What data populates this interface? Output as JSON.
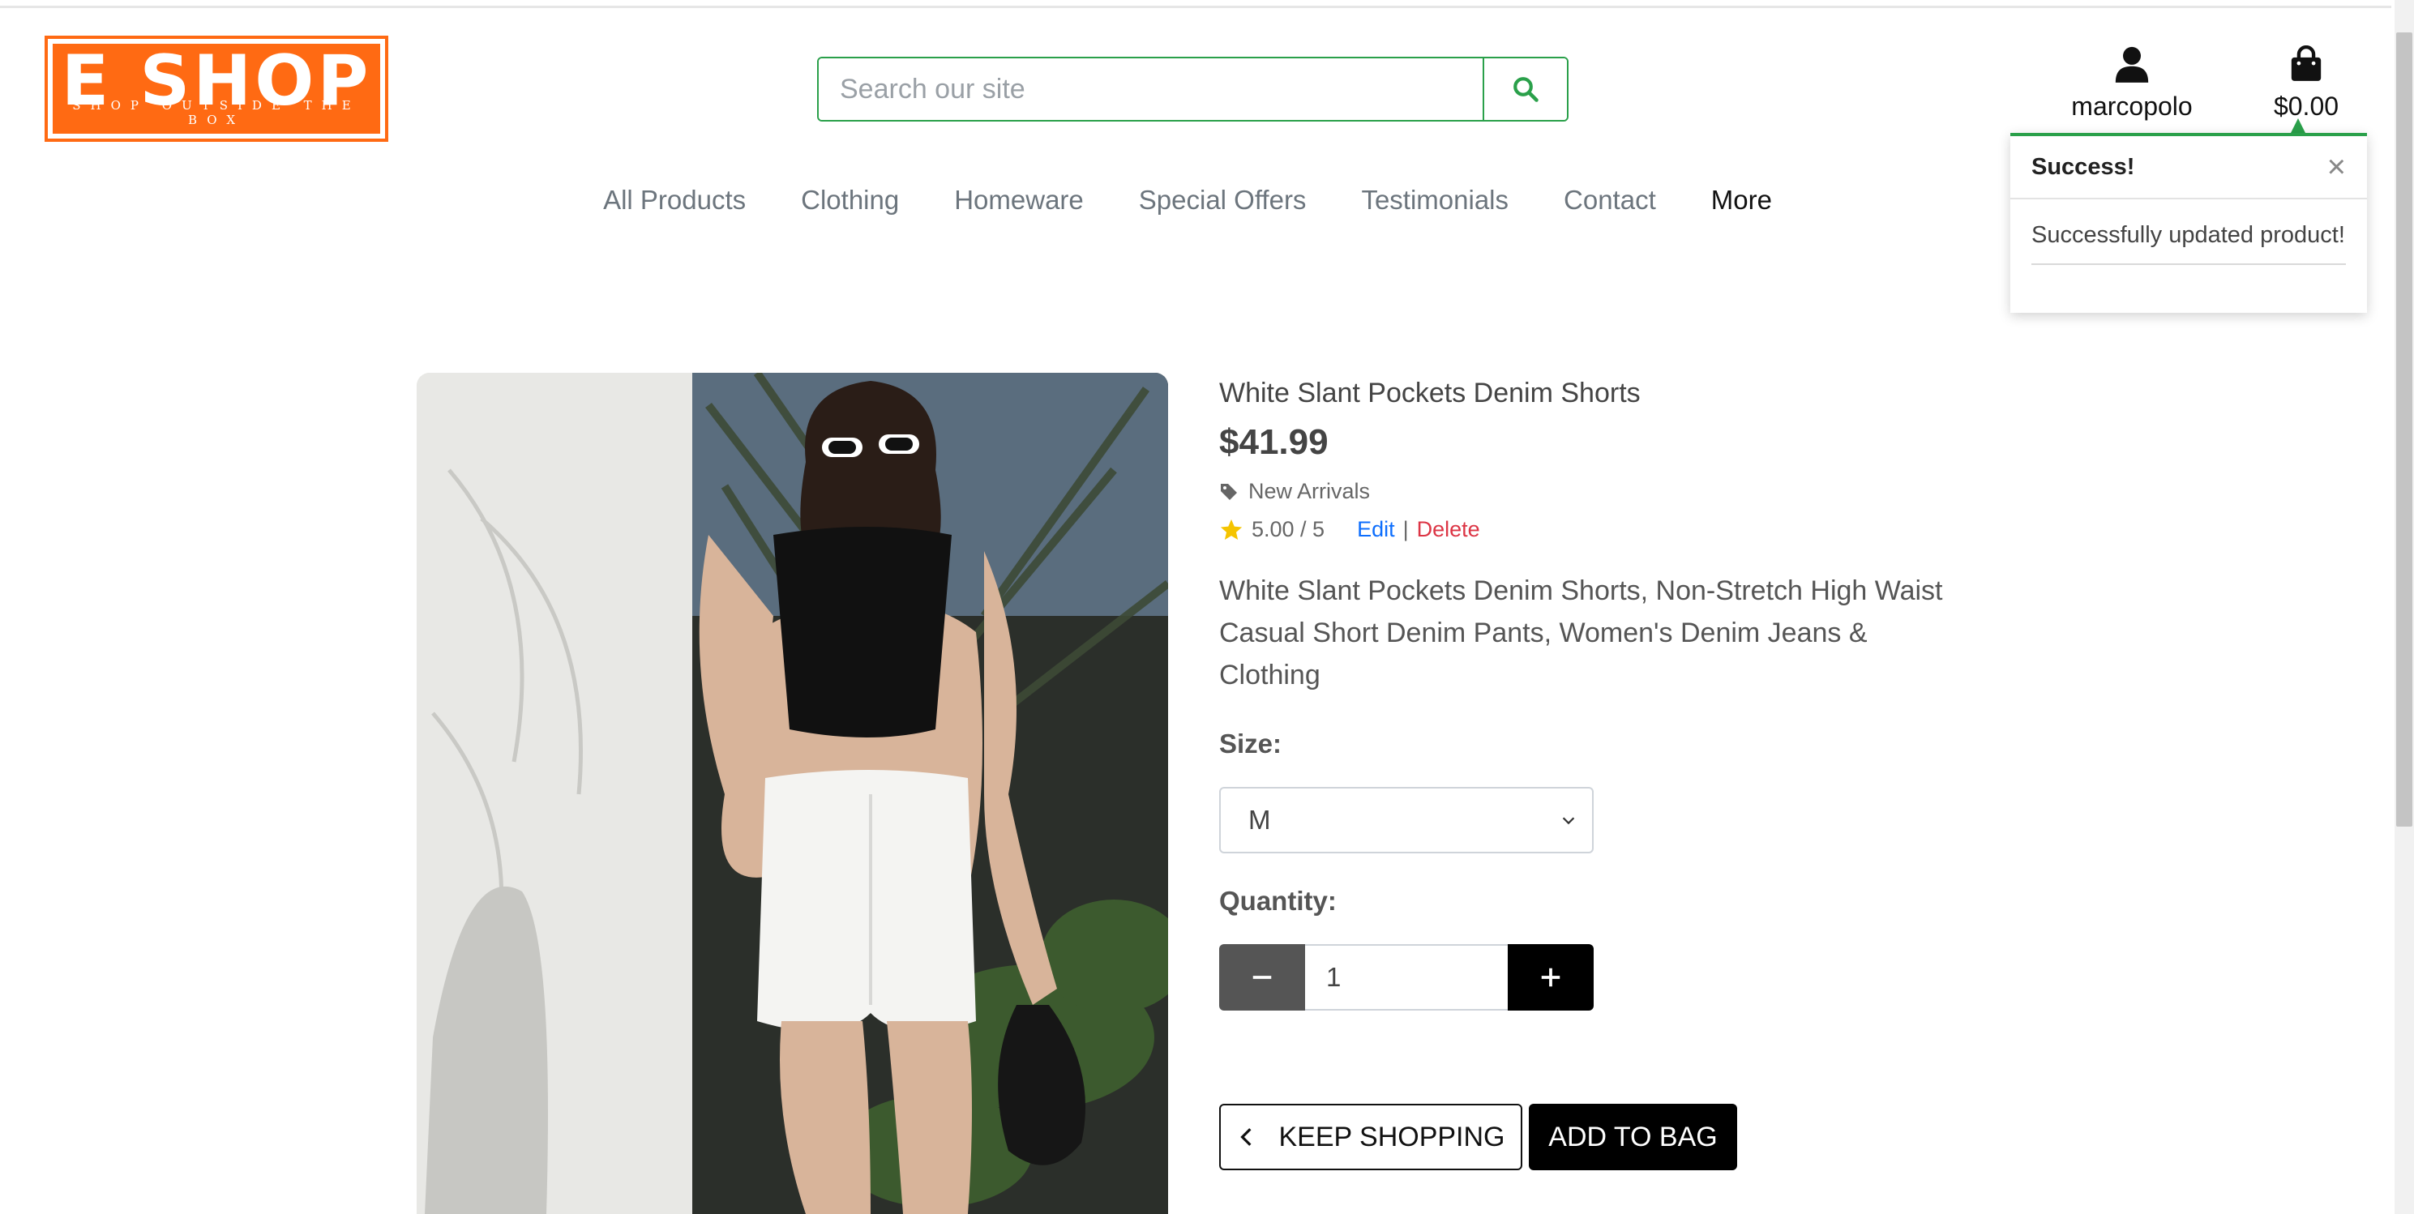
{
  "brand": {
    "name": "E SHOP",
    "tagline": "SHOP OUTSIDE THE BOX",
    "color": "#ff6a13"
  },
  "search": {
    "placeholder": "Search our site",
    "icon": "search-icon",
    "accent": "#2aa04a"
  },
  "account": {
    "username": "marcopolo",
    "icon": "user-icon"
  },
  "bag": {
    "total": "$0.00",
    "icon": "shopping-bag-icon"
  },
  "nav": {
    "items": [
      "All Products",
      "Clothing",
      "Homeware",
      "Special Offers",
      "Testimonials",
      "Contact"
    ],
    "more": "More"
  },
  "toast": {
    "title": "Success!",
    "message": "Successfully updated product!",
    "close": "×"
  },
  "product": {
    "name": "White Slant Pockets Denim Shorts",
    "price": "$41.99",
    "category": "New Arrivals",
    "rating": "5.00 / 5",
    "edit_label": "Edit",
    "separator": "|",
    "delete_label": "Delete",
    "description": "White Slant Pockets Denim Shorts, Non-Stretch High Waist Casual Short Denim Pants, Women's Denim Jeans & Clothing",
    "size_label": "Size:",
    "size_value": "M",
    "quantity_label": "Quantity:",
    "quantity_value": "1"
  },
  "actions": {
    "keep_shopping": "KEEP SHOPPING",
    "add_to_bag": "ADD TO BAG"
  }
}
